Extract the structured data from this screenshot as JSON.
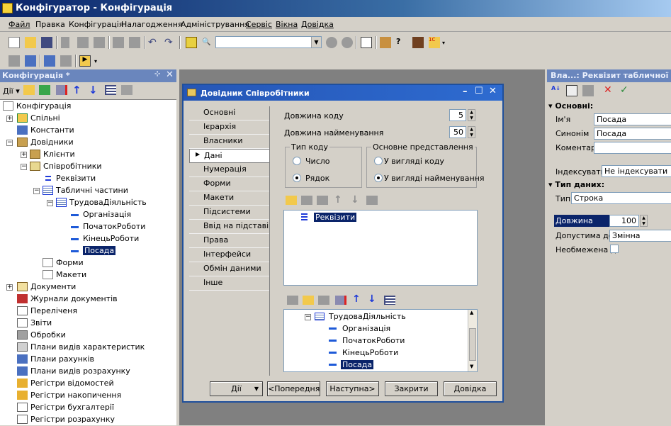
{
  "window": {
    "title": "Конфігуратор - Конфігурація"
  },
  "menu": [
    "Файл",
    "Правка",
    "Конфігурація",
    "Налагодження",
    "Адміністрування",
    "Сервіс",
    "Вікна",
    "Довідка"
  ],
  "left_panel": {
    "title": "Конфігурація *",
    "actions_label": "Дії",
    "tree": {
      "root": "Конфігурація",
      "common": "Спільні",
      "constants": "Константи",
      "catalogs": "Довідники",
      "clients": "Клієнти",
      "employees": "Співробітники",
      "attributes": "Реквізити",
      "tabular_parts": "Табличні частини",
      "work_history": "ТрудоваДіяльність",
      "organization": "Організація",
      "start_work": "ПочатокРоботи",
      "end_work": "КінецьРоботи",
      "position": "Посада",
      "forms": "Форми",
      "layouts": "Макети",
      "documents": "Документи",
      "doc_journals": "Журнали документів",
      "enums": "Переліченя",
      "reports": "Звіти",
      "processing": "Обробки",
      "char_types": "Плани видів характеристик",
      "accounts": "Плани рахунків",
      "calc_types": "Плани видів розрахунку",
      "info_registers": "Регістри відомостей",
      "accum_registers": "Регістри накопичення",
      "acc_registers": "Регістри бухгалтерії",
      "calc_registers": "Регістри розрахунку"
    }
  },
  "dialog": {
    "title": "Довідник Співробітники",
    "tabs": [
      "Основні",
      "Ієрархія",
      "Власники",
      "Дані",
      "Нумерація",
      "Форми",
      "Макети",
      "Підсистеми",
      "Ввід на підставі",
      "Права",
      "Інтерфейси",
      "Обмін даними",
      "Інше"
    ],
    "active_tab": "Дані",
    "code_length_label": "Довжина коду",
    "code_length": "5",
    "name_length_label": "Довжина найменування",
    "name_length": "50",
    "code_type_title": "Тип коду",
    "code_type_number": "Число",
    "code_type_string": "Рядок",
    "main_repr_title": "Основне представлення",
    "repr_code": "У вигляді коду",
    "repr_name": "У вигляді найменування",
    "attrs_item": "Реквізити",
    "tab_parts": {
      "parent": "ТрудоваДіяльність",
      "items": [
        "Організація",
        "ПочатокРоботи",
        "КінецьРоботи",
        "Посада"
      ]
    },
    "buttons": {
      "actions": "Дії",
      "prev": "<Попередня",
      "next": "Наступна>",
      "close": "Закрити",
      "help": "Довідка"
    }
  },
  "right_panel": {
    "title": "Вла...: Реквізит табличної ча",
    "basic_section": "Основні:",
    "name_label": "Ім'я",
    "name_value": "Посада",
    "synonym_label": "Синонім",
    "synonym_value": "Посада",
    "comment_label": "Коментар",
    "comment_value": "",
    "index_label": "Індексувати",
    "index_value": "Не індексувати",
    "datatype_section": "Тип даних:",
    "type_label": "Тип",
    "type_value": "Строка",
    "length_label": "Довжина",
    "length_value": "100",
    "allowed_len_label": "Допустима до",
    "allowed_len_value": "Змінна",
    "unlimited_label": "Необмежена д"
  }
}
